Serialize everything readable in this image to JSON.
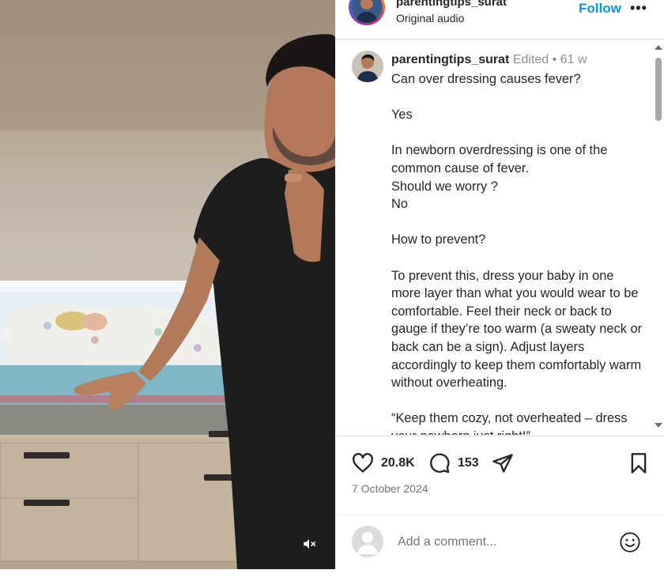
{
  "header": {
    "username": "parentingtips_surat",
    "audio": "Original audio",
    "follow_label": "Follow",
    "more_label": "•••"
  },
  "caption": {
    "username": "parentingtips_surat",
    "edited": "Edited",
    "dot": "•",
    "age": "61 w",
    "body": "Can over dressing causes fever?\n\nYes\n\nIn newborn overdressing is one of the common cause of fever.\nShould we worry ?\nNo\n\nHow to prevent?\n\nTo prevent this, dress your baby in one more layer than what you would wear to be comfortable. Feel their neck or back to gauge if they’re too warm (a sweaty neck or back can be a sign). Adjust layers accordingly to keep them comfortably warm without overheating.\n\n“Keep them cozy, not overheated – dress your newborn just right!”"
  },
  "actions": {
    "likes": "20.8K",
    "comments": "153",
    "date": "7 October 2024"
  },
  "comment": {
    "placeholder": "Add a comment..."
  },
  "icons": {
    "like": "heart-icon",
    "comment": "speech-bubble-icon",
    "share": "paper-plane-icon",
    "save": "bookmark-icon",
    "mute": "speaker-muted-icon",
    "emoji": "smiley-icon"
  },
  "colors": {
    "accent": "#0095f6",
    "text": "#262626",
    "muted": "#8e8e8e"
  }
}
